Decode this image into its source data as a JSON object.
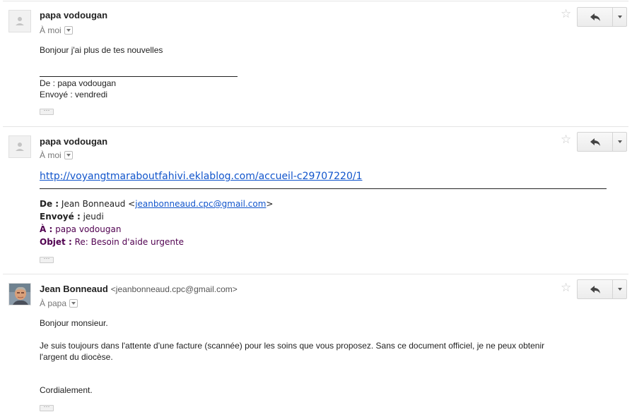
{
  "messages": [
    {
      "sender": "papa vodougan",
      "to_label": "À moi",
      "body": {
        "line1": "Bonjour j'ai plus de tes nouvelles",
        "from_line": "De : papa vodougan",
        "sent_line": "Envoyé : vendredi"
      },
      "dots": "..."
    },
    {
      "sender": "papa vodougan",
      "to_label": "À moi",
      "link": "http://voyangtmaraboutfahivi.eklablog.com/accueil-c29707220/1",
      "quoted": {
        "from_label": "De :",
        "from_name": "Jean Bonneaud <",
        "from_email": "jeanbonneaud.cpc@gmail.com",
        "from_end": ">",
        "sent_label": "Envoyé :",
        "sent_value": "jeudi",
        "to_label": "À :",
        "to_value": "papa vodougan",
        "subject_label": "Objet :",
        "subject_value": "Re: Besoin d'aide urgente"
      },
      "dots": "..."
    },
    {
      "sender": "Jean Bonneaud",
      "sender_email": "<jeanbonneaud.cpc@gmail.com>",
      "to_label": "À papa",
      "body": {
        "greeting": "Bonjour monsieur.",
        "paragraph_line1": "Je suis toujours dans l'attente d'une facture (scannée) pour les soins que vous proposez. Sans ce document officiel, je ne peux obtenir",
        "paragraph_line2": "l'argent du diocèse.",
        "closing": "Cordialement."
      },
      "dots": "..."
    }
  ],
  "icons": {
    "star": "star-icon",
    "reply": "reply-icon",
    "more": "chevron-down-icon",
    "avatar_default": "person-icon"
  },
  "colors": {
    "link": "#1155cc",
    "quoted_header": "#500050",
    "star": "#c9c9c9"
  }
}
